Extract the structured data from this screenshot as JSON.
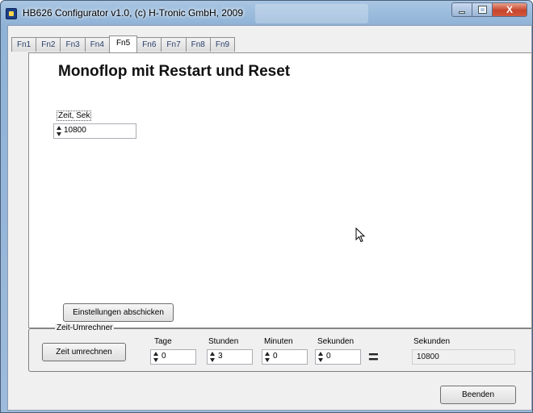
{
  "window": {
    "title": "HB626 Configurator v1.0, (c) H-Tronic GmbH, 2009",
    "close_glyph": "X"
  },
  "tabs": [
    {
      "label": "Fn1"
    },
    {
      "label": "Fn2"
    },
    {
      "label": "Fn3"
    },
    {
      "label": "Fn4"
    },
    {
      "label": "Fn5",
      "active": true
    },
    {
      "label": "Fn6"
    },
    {
      "label": "Fn7"
    },
    {
      "label": "Fn8"
    },
    {
      "label": "Fn9"
    }
  ],
  "panel": {
    "title": "Monoflop mit Restart und Reset",
    "time_label": "Zeit, Sek",
    "time_value": "10800",
    "submit_label": "Einstellungen abschicken"
  },
  "converter": {
    "legend": "Zeit-Umrechner",
    "button_label": "Zeit umrechnen",
    "days_label": "Tage",
    "days_value": "0",
    "hours_label": "Stunden",
    "hours_value": "3",
    "minutes_label": "Minuten",
    "minutes_value": "0",
    "seconds_label": "Sekunden",
    "seconds_value": "0",
    "equals": "=",
    "result_label": "Sekunden",
    "result_value": "10800"
  },
  "footer": {
    "quit_label": "Beenden"
  },
  "colors": {
    "title_bar": "#9dbbdc",
    "client_bg": "#f0f0f0",
    "close_button": "#c7452b"
  },
  "icons": [
    "app-icon",
    "minimize-icon",
    "maximize-icon",
    "close-icon",
    "mouse-cursor-icon"
  ]
}
